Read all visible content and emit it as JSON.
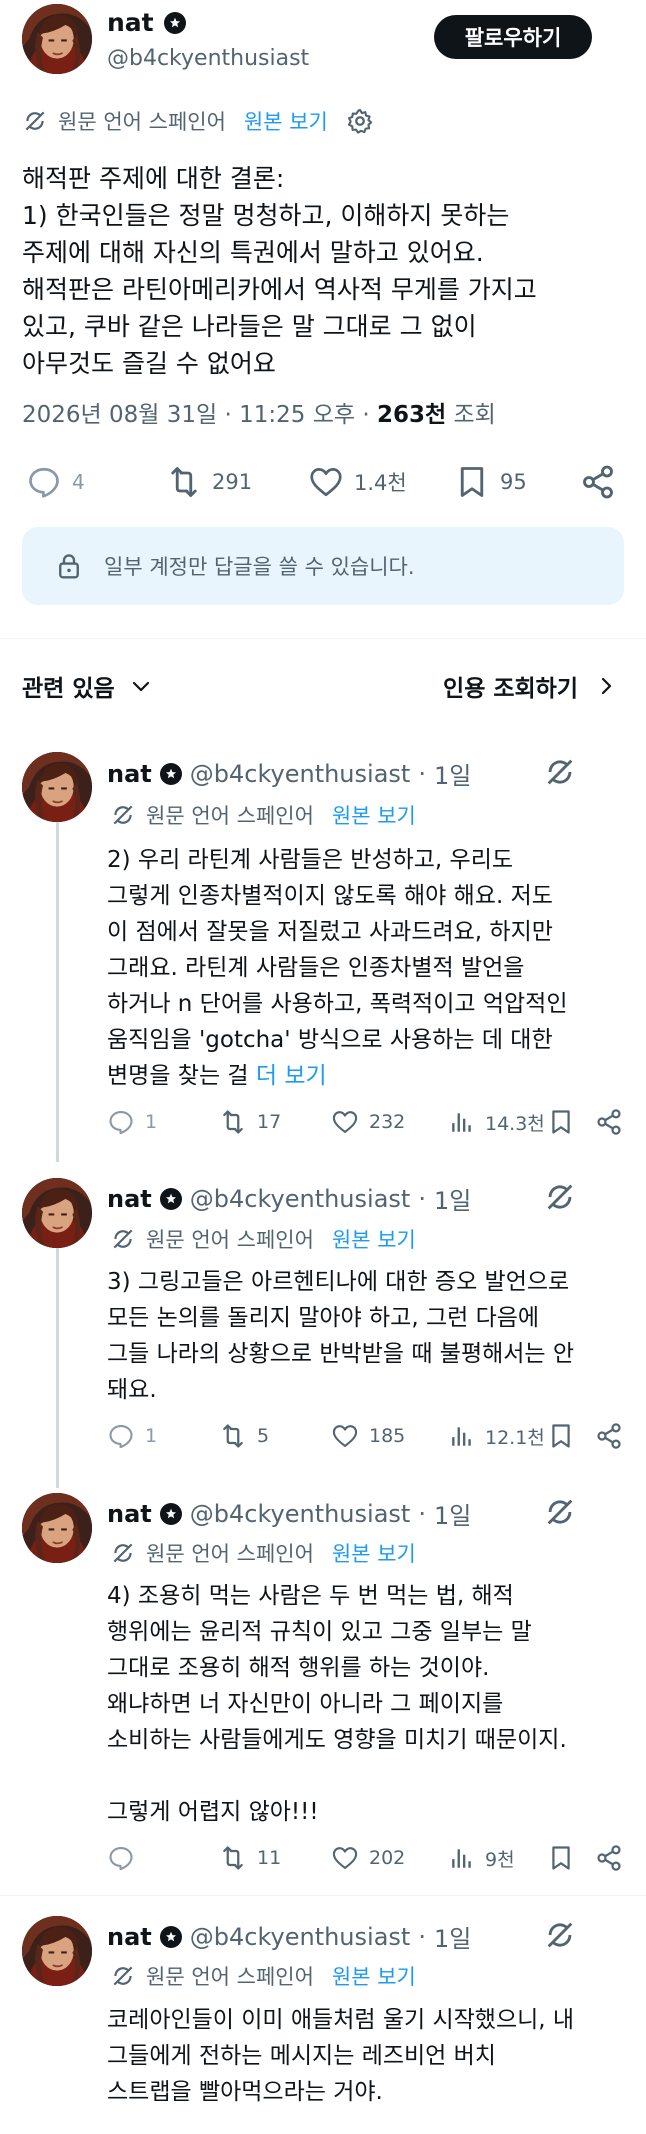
{
  "author": {
    "name": "nat",
    "handle": "@b4ckyenthusiast",
    "follow_label": "팔로우하기"
  },
  "translation": {
    "note": "원문 언어 스페인어",
    "show_original": "원본 보기"
  },
  "post": {
    "text": "해적판 주제에 대한 결론:\n1) 한국인들은 정말 멍청하고, 이해하지 못하는\n주제에 대해 자신의 특권에서 말하고 있어요.\n해적판은 라틴아메리카에서 역사적 무게를 가지고\n있고, 쿠바 같은 나라들은 말 그대로 그 없이\n아무것도 즐길 수 없어요",
    "date": "2026년 08월 31일",
    "time": "11:25 오후",
    "views_count": "263천",
    "views_label": "조회",
    "stats": {
      "replies": "4",
      "reposts": "291",
      "likes": "1.4천",
      "bookmarks": "95"
    },
    "restricted_notice": "일부 계정만 답글을 쓸 수 있습니다."
  },
  "tabs": {
    "related": "관련 있음",
    "quotes": "인용 조회하기"
  },
  "replies": [
    {
      "name": "nat",
      "handle": "@b4ckyenthusiast",
      "time": "1일",
      "text": "2) 우리 라틴계 사람들은 반성하고, 우리도\n그렇게 인종차별적이지 않도록 해야 해요. 저도\n이 점에서 잘못을 저질렀고 사과드려요, 하지만\n그래요. 라틴계 사람들은 인종차별적 발언을\n하거나 n 단어를 사용하고, 폭력적이고 억압적인\n움직임을 'gotcha' 방식으로 사용하는 데 대한\n변명을 찾는 걸 ",
      "more": "더 보기",
      "replies": "1",
      "reposts": "17",
      "likes": "232",
      "views": "14.3천"
    },
    {
      "name": "nat",
      "handle": "@b4ckyenthusiast",
      "time": "1일",
      "text": "3) 그링고들은 아르헨티나에 대한 증오 발언으로\n모든 논의를 돌리지 말아야 하고, 그런 다음에\n그들 나라의 상황으로 반박받을 때 불평해서는 안\n돼요.",
      "more": "",
      "replies": "1",
      "reposts": "5",
      "likes": "185",
      "views": "12.1천"
    },
    {
      "name": "nat",
      "handle": "@b4ckyenthusiast",
      "time": "1일",
      "text": "4) 조용히 먹는 사람은 두 번 먹는 법, 해적\n행위에는 윤리적 규칙이 있고 그중 일부는 말\n그대로 조용히 해적 행위를 하는 것이야.\n왜냐하면 너 자신만이 아니라 그 페이지를\n소비하는 사람들에게도 영향을 미치기 때문이지.\n\n그렇게 어렵지 않아!!!",
      "more": "",
      "replies": "",
      "reposts": "11",
      "likes": "202",
      "views": "9천"
    },
    {
      "name": "nat",
      "handle": "@b4ckyenthusiast",
      "time": "1일",
      "text": "코레아인들이 이미 애들처럼 울기 시작했으니, 내\n그들에게 전하는 메시지는 레즈비언 버치\n스트랩을 빨아먹으라는 거야.",
      "more": ""
    }
  ],
  "colors": {
    "text_primary": "#0f1419",
    "text_secondary": "#536471",
    "accent": "#1d9bf0",
    "notice_bg": "#e8f5fd"
  }
}
